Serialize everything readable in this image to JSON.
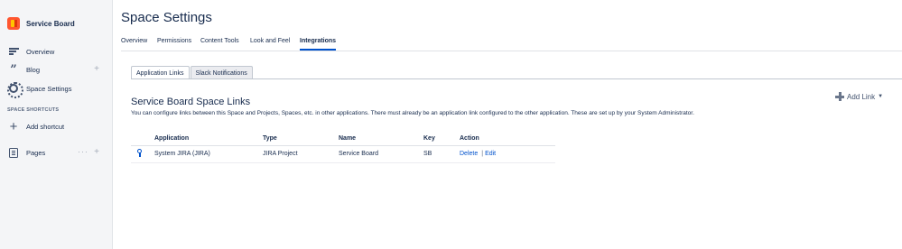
{
  "sidebar": {
    "space_name": "Service Board",
    "items": [
      {
        "label": "Overview",
        "icon": "overview-icon"
      },
      {
        "label": "Blog",
        "icon": "blog-icon"
      },
      {
        "label": "Space Settings",
        "icon": "gear-icon"
      }
    ],
    "shortcuts_heading": "SPACE SHORTCUTS",
    "add_shortcut": "Add shortcut",
    "pages_label": "Pages",
    "plus_glyph": "+",
    "dots_glyph": "···"
  },
  "header": {
    "title": "Space Settings",
    "tabs": [
      {
        "label": "Overview",
        "active": false
      },
      {
        "label": "Permissions",
        "active": false
      },
      {
        "label": "Content Tools",
        "active": false
      },
      {
        "label": "Look and Feel",
        "active": false
      },
      {
        "label": "Integrations",
        "active": true
      }
    ]
  },
  "subtabs": [
    {
      "label": "Application Links",
      "active": true
    },
    {
      "label": "Slack Notifications",
      "active": false
    }
  ],
  "section": {
    "title": "Service Board Space Links",
    "description": "You can configure links between this Space and Projects, Spaces, etc. in other applications. There must already be an application link configured to the other application. These are set up by your System Administrator.",
    "add_link": "Add Link"
  },
  "table": {
    "headers": [
      "Application",
      "Type",
      "Name",
      "Key",
      "Action"
    ],
    "rows": [
      {
        "application": "System JIRA (JIRA)",
        "type": "JIRA Project",
        "name": "Service Board",
        "key": "SB",
        "delete": "Delete",
        "separator": "|",
        "edit": "Edit"
      }
    ]
  },
  "colors": {
    "accent": "#0052cc",
    "sidebar_bg": "#f4f5f7",
    "text": "#172b4d"
  }
}
